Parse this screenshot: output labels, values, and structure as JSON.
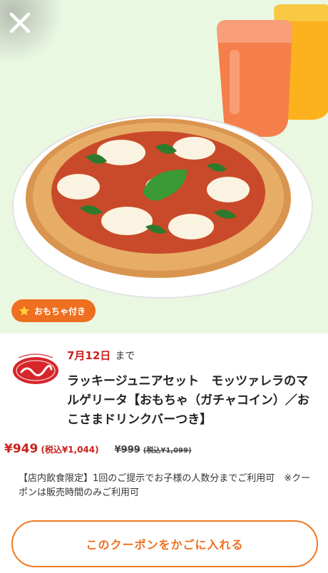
{
  "header": {
    "close_icon": "close-icon"
  },
  "hero": {
    "image_subject": "margherita-pizza-with-drinks",
    "badge_label": "おもちゃ付き",
    "badge_icon": "star-icon",
    "colors": {
      "background": "#eaf8e2",
      "badge": "#ee6f1f"
    }
  },
  "coupon": {
    "deadline_date": "7月12日",
    "deadline_suffix": "まで",
    "brand_logo": "jonathan-logo",
    "title": "ラッキージュニアセット　モッツァレラのマルゲリータ【おもちゃ（ガチャコイン）／おこさまドリンクバーつき】",
    "price": "¥949",
    "price_tax": "(税込¥1,044)",
    "original_price": "¥999",
    "original_price_tax": "(税込¥1,099)",
    "note": "【店内飲食限定】1回のご提示でお子様の人数分までご利用可　※クーポンは販売時間のみご利用可"
  },
  "actions": {
    "add_to_cart_label": "このクーポンをかごに入れる"
  },
  "colors": {
    "accent": "#ee6f1f",
    "price_red": "#c8231e"
  }
}
